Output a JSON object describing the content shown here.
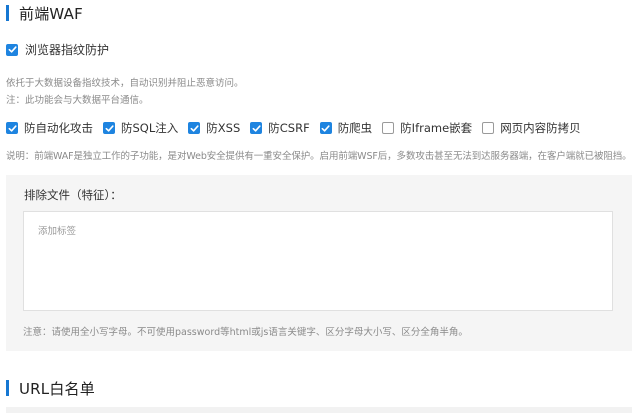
{
  "waf_section": {
    "title": "前端WAF"
  },
  "fingerprint": {
    "checked": true,
    "label": "浏览器指纹防护",
    "hint1": "依托于大数据设备指纹技术，自动识别并阻止恶意访问。",
    "hint2": "注：此功能会与大数据平台通信。"
  },
  "options": [
    {
      "label": "防自动化攻击",
      "checked": true
    },
    {
      "label": "防SQL注入",
      "checked": true
    },
    {
      "label": "防XSS",
      "checked": true
    },
    {
      "label": "防CSRF",
      "checked": true
    },
    {
      "label": "防爬虫",
      "checked": true
    },
    {
      "label": "防Iframe嵌套",
      "checked": false
    },
    {
      "label": "网页内容防拷贝",
      "checked": false
    }
  ],
  "description": "说明：前端WAF是独立工作的子功能，是对Web安全提供有一重安全保护。启用前端WSF后，多数攻击甚至无法到达服务器端，在客户端就已被阻挡。",
  "exclude_panel": {
    "label": "排除文件（特征）：",
    "tag_placeholder": "添加标签",
    "note": "注意：请使用全小写字母。不可使用password等html或js语言关键字、区分字母大小写、区分全角半角。"
  },
  "url_section": {
    "title": "URL白名单"
  },
  "colors": {
    "accent": "#1e84e0",
    "title_bar": "#1677d2",
    "hint_text": "#8a8a8a",
    "panel_bg": "#f5f5f5"
  }
}
